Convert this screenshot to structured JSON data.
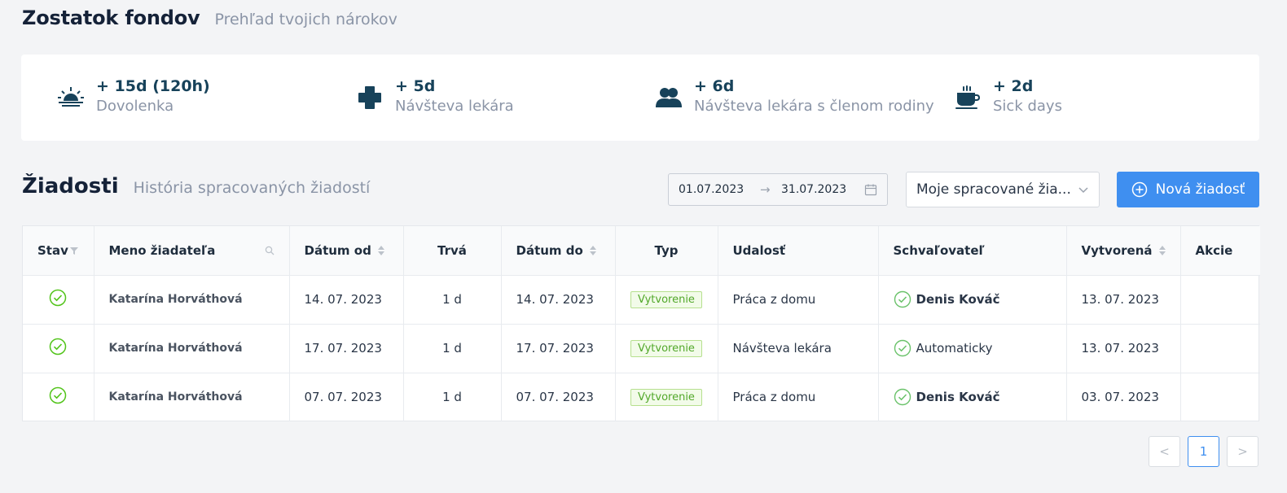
{
  "header": {
    "title": "Zostatok fondov",
    "subtitle": "Prehľad tvojich nárokov"
  },
  "balances": [
    {
      "value": "+ 15d (120h)",
      "label": "Dovolenka",
      "icon": "sunrise-icon"
    },
    {
      "value": "+ 5d",
      "label": "Návšteva lekára",
      "icon": "medical-cross-icon"
    },
    {
      "value": "+ 6d",
      "label": "Návšteva lekára s členom rodiny",
      "icon": "people-icon"
    },
    {
      "value": "+ 2d",
      "label": "Sick days",
      "icon": "coffee-cup-icon"
    }
  ],
  "requests": {
    "title": "Žiadosti",
    "subtitle": "História spracovaných žiadostí",
    "date_from": "01.07.2023",
    "date_to": "31.07.2023",
    "filter_value": "Moje spracované žia...",
    "new_button": "Nová žiadosť"
  },
  "table": {
    "columns": [
      "Stav",
      "Meno žiadateľa",
      "Dátum od",
      "Trvá",
      "Dátum do",
      "Typ",
      "Udalosť",
      "Schvaľovateľ",
      "Vytvorená",
      "Akcie"
    ],
    "rows": [
      {
        "name": "Katarína Horváthová",
        "from": "14. 07. 2023",
        "duration": "1 d",
        "to": "14. 07. 2023",
        "type": "Vytvorenie",
        "event": "Práca z domu",
        "approver": "Denis Kováč",
        "approver_bold": true,
        "created": "13. 07. 2023"
      },
      {
        "name": "Katarína Horváthová",
        "from": "17. 07. 2023",
        "duration": "1 d",
        "to": "17. 07. 2023",
        "type": "Vytvorenie",
        "event": "Návšteva lekára",
        "approver": "Automaticky",
        "approver_bold": false,
        "created": "13. 07. 2023"
      },
      {
        "name": "Katarína Horváthová",
        "from": "07. 07. 2023",
        "duration": "1 d",
        "to": "07. 07. 2023",
        "type": "Vytvorenie",
        "event": "Práca z domu",
        "approver": "Denis Kováč",
        "approver_bold": true,
        "created": "03. 07. 2023"
      }
    ]
  },
  "pagination": {
    "current_page": "1",
    "prev": "<",
    "next": ">"
  },
  "colors": {
    "accent": "#3f8ff0",
    "success": "#52c41a",
    "dark_teal": "#17425a"
  }
}
